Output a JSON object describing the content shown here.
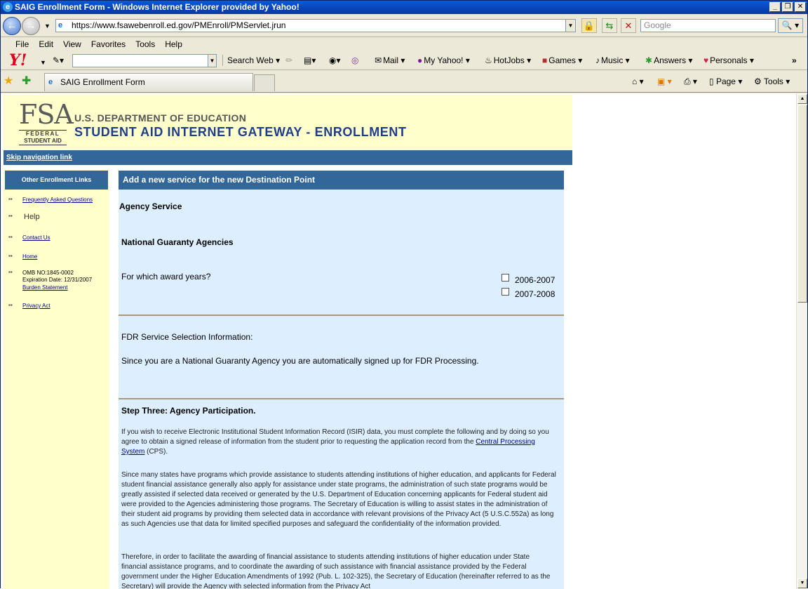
{
  "window": {
    "title": "SAIG Enrollment Form - Windows Internet Explorer provided by Yahoo!",
    "url": "https://www.fsawebenroll.ed.gov/PMEnroll/PMServlet.jrun",
    "search_placeholder": "Google"
  },
  "menu": [
    "File",
    "Edit",
    "View",
    "Favorites",
    "Tools",
    "Help"
  ],
  "yahoo_toolbar": {
    "search_web": "Search Web",
    "items": [
      "Mail",
      "My Yahoo!",
      "HotJobs",
      "Games",
      "Music",
      "Answers",
      "Personals"
    ]
  },
  "tab": {
    "label": "SAIG Enrollment Form"
  },
  "commands": {
    "page": "Page",
    "tools": "Tools"
  },
  "header": {
    "logo_big": "FSA",
    "logo_line1": "FEDERAL",
    "logo_line2": "STUDENT AID",
    "dept": "U.S. DEPARTMENT OF EDUCATION",
    "title": "STUDENT AID INTERNET GATEWAY - ENROLLMENT",
    "skip_link": "Skip navigation link"
  },
  "sidebar": {
    "heading": "Other Enrollment Links",
    "faq": "Frequently Asked Questions",
    "help": "Help",
    "contact": "Contact Us",
    "home": "Home",
    "omb": "OMB NO:1845-0002",
    "expiration": "Expiration Date: 12/31/2007",
    "burden": "Burden Statement",
    "privacy": "Privacy Act"
  },
  "main": {
    "heading": "Add a new service for the new Destination Point",
    "agency_service": "Agency Service",
    "agency_type": "National Guaranty Agencies",
    "award_question": "For which award years?",
    "years": [
      {
        "label": "2006-2007",
        "checked": false
      },
      {
        "label": "2007-2008",
        "checked": false
      }
    ],
    "fdr_title": "FDR Service Selection Information:",
    "fdr_text": "Since you are a National Guaranty Agency you are automatically signed up for FDR Processing.",
    "step_three": "Step Three: Agency Participation.",
    "para1_a": "If you wish to receive Electronic Institutional Student Information Record (ISIR) data, you must complete the following and by doing so you agree to obtain a signed release of information from the student prior to requesting the application record from the",
    "para1_link": "Central Processing System",
    "para1_b": "(CPS).",
    "para2": "Since many states have programs which provide assistance to students attending institutions of higher education, and applicants for Federal student financial assistance generally also apply for assistance under state programs, the administration of such state programs would be greatly assisted if selected data received or generated by the U.S. Department of Education concerning applicants for Federal student aid were provided to the Agencies administering those programs. The Secretary of Education is willing to assist states in the administration of their student aid programs by providing them selected data in accordance with relevant provisions of the Privacy Act (5 U.S.C.552a) as long as such Agencies use that data for limited specified purposes and safeguard the confidentiality of the information provided.",
    "para3": "Therefore, in order to facilitate the awarding of financial assistance to students attending institutions of higher education under State financial assistance programs, and to coordinate the awarding of such assistance with financial assistance provided by the Federal government under the Higher Education Amendments of 1992 (Pub. L. 102-325), the Secretary of Education (hereinafter referred to as the Secretary) will provide the Agency with selected information from the Privacy Act"
  }
}
